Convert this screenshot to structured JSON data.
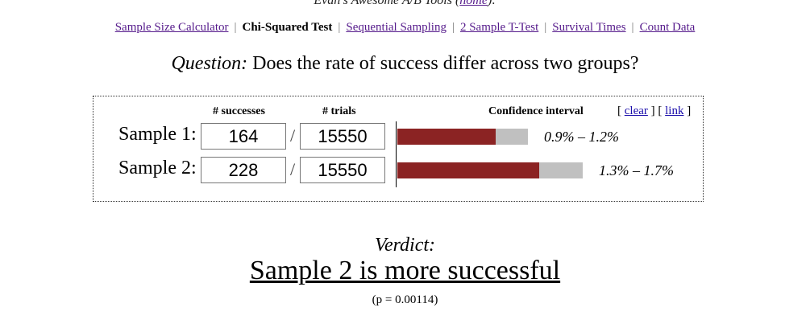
{
  "header": {
    "title": "Evan's Awesome A/B Tools",
    "home_link": "home"
  },
  "nav": {
    "items": [
      {
        "label": "Sample Size Calculator",
        "current": false
      },
      {
        "label": "Chi-Squared Test",
        "current": true
      },
      {
        "label": "Sequential Sampling",
        "current": false
      },
      {
        "label": "2 Sample T-Test",
        "current": false
      },
      {
        "label": "Survival Times",
        "current": false
      },
      {
        "label": "Count Data",
        "current": false
      }
    ]
  },
  "question": {
    "prefix": "Question:",
    "text": "Does the rate of success differ across two groups?"
  },
  "panel": {
    "col_successes": "# successes",
    "col_trials": "# trials",
    "col_ci": "Confidence interval",
    "clear_label": "clear",
    "link_label": "link"
  },
  "samples": [
    {
      "label": "Sample 1:",
      "successes": "164",
      "trials": "15550",
      "ci_text": "0.9% – 1.2%",
      "ci_low_pct": 0.9,
      "ci_high_pct": 1.2
    },
    {
      "label": "Sample 2:",
      "successes": "228",
      "trials": "15550",
      "ci_text": "1.3% – 1.7%",
      "ci_low_pct": 1.3,
      "ci_high_pct": 1.7
    }
  ],
  "verdict": {
    "label": "Verdict:",
    "text": "Sample 2 is more successful",
    "p_value": "(p = 0.00114)"
  },
  "colors": {
    "bar_fill": "#8b2323",
    "bar_background": "#c0c0c0",
    "link_visited": "#551a8b"
  }
}
